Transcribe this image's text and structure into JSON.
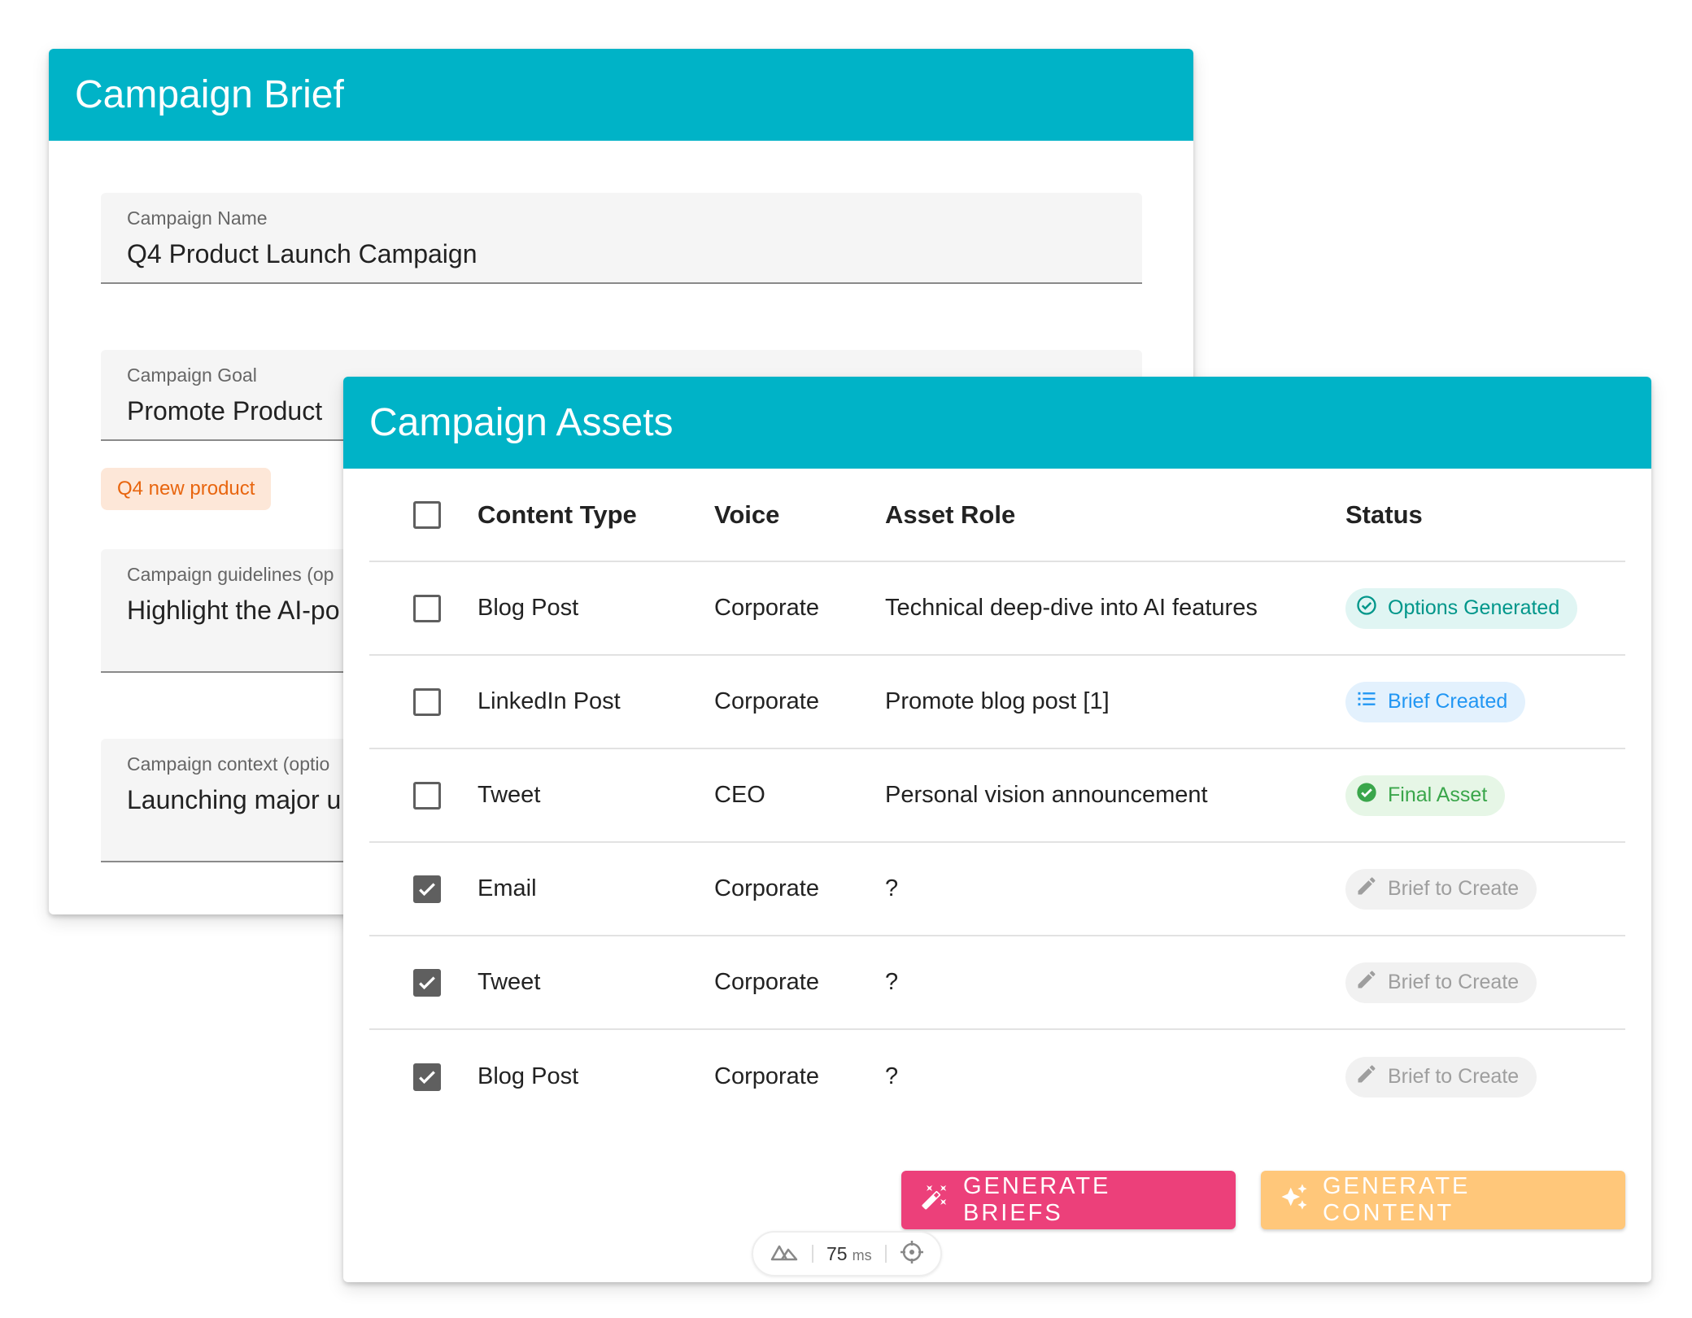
{
  "brief": {
    "title": "Campaign Brief",
    "fields": [
      {
        "label": "Campaign Name",
        "value": "Q4 Product Launch Campaign"
      },
      {
        "label": "Campaign Goal",
        "value": "Promote Product"
      },
      {
        "label": "Campaign guidelines (op",
        "value": "Highlight the AI-po"
      },
      {
        "label": "Campaign context (optio",
        "value": "Launching major u"
      }
    ],
    "tag": "Q4 new product"
  },
  "assets": {
    "title": "Campaign Assets",
    "columns": {
      "type": "Content Type",
      "voice": "Voice",
      "role": "Asset Role",
      "status": "Status"
    },
    "rows": [
      {
        "checked": false,
        "type": "Blog Post",
        "voice": "Corporate",
        "role": "Technical deep-dive into AI features",
        "status": "Options Generated",
        "status_icon": "check-circle-outline-icon",
        "status_color": "#00968a"
      },
      {
        "checked": false,
        "type": "LinkedIn Post",
        "voice": "Corporate",
        "role": "Promote blog post [1]",
        "status": "Brief Created",
        "status_icon": "list-icon",
        "status_color": "#2196f3"
      },
      {
        "checked": false,
        "type": "Tweet",
        "voice": "CEO",
        "role": "Personal vision announcement",
        "status": "Final Asset",
        "status_icon": "check-circle-filled-icon",
        "status_color": "#3aa64b"
      },
      {
        "checked": true,
        "type": "Email",
        "voice": "Corporate",
        "role": "?",
        "status": "Brief to Create",
        "status_icon": "pencil-icon",
        "status_color": "#9e9e9e"
      },
      {
        "checked": true,
        "type": "Tweet",
        "voice": "Corporate",
        "role": "?",
        "status": "Brief to Create",
        "status_icon": "pencil-icon",
        "status_color": "#9e9e9e"
      },
      {
        "checked": true,
        "type": "Blog Post",
        "voice": "Corporate",
        "role": "?",
        "status": "Brief to Create",
        "status_icon": "pencil-icon",
        "status_color": "#9e9e9e"
      }
    ],
    "buttons": {
      "generate_briefs": "GENERATE BRIEFS",
      "generate_content": "GENERATE CONTENT"
    }
  },
  "perf": {
    "value": "75",
    "unit": "ms"
  },
  "colors": {
    "header": "#00b3c7",
    "briefs_button": "#ec407a",
    "content_button": "#ffc77a",
    "tag_bg": "#fde7d8",
    "tag_text": "#e8650e"
  }
}
